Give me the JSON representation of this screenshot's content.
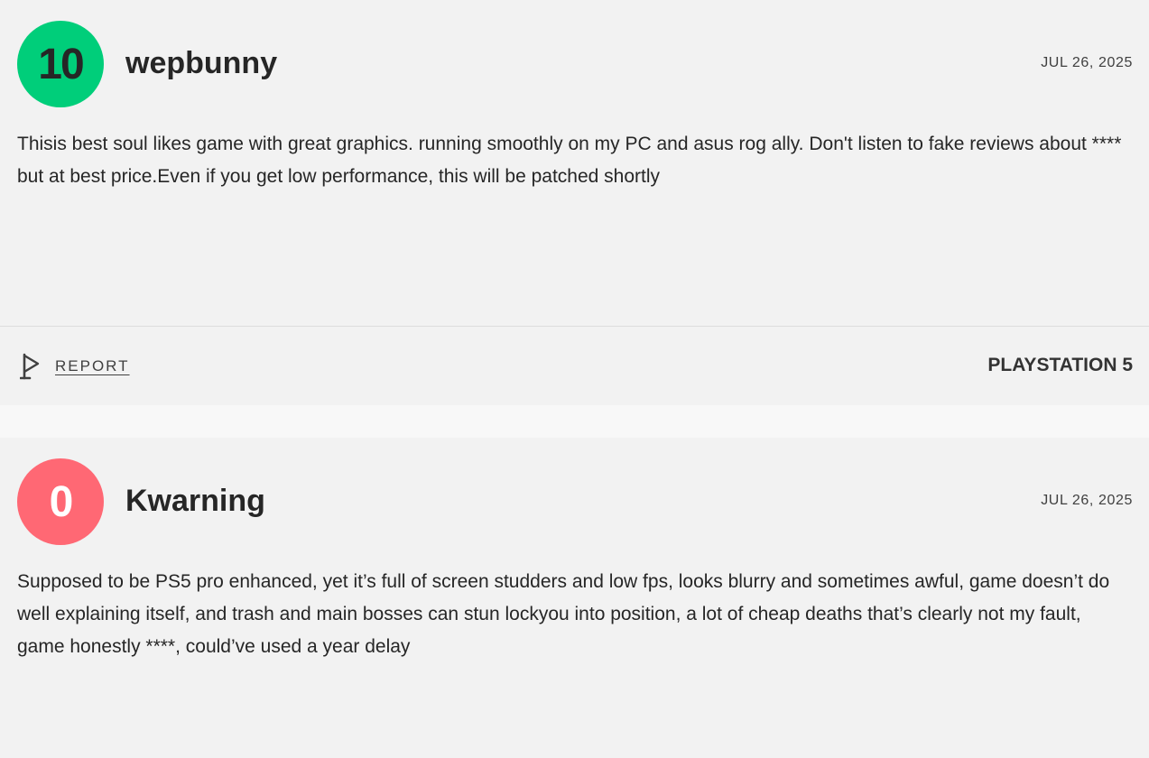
{
  "reviews": [
    {
      "score": "10",
      "score_color": "#00ce7a",
      "username": "wepbunny",
      "date": "JUL 26, 2025",
      "text": "Thisis best soul likes game with great graphics. running smoothly on my PC and asus rog ally. Don't listen to fake reviews about **** but at best price.Even if you get low performance, this will be patched shortly",
      "report_label": "REPORT",
      "report_icon": "flag-icon",
      "platform": "PLAYSTATION 5"
    },
    {
      "score": "0",
      "score_color": "#ff6874",
      "username": "Kwarning",
      "date": "JUL 26, 2025",
      "text": "Supposed to be PS5 pro enhanced, yet it’s full of screen studders and low fps, looks blurry and sometimes awful, game doesn’t do well explaining itself, and trash and main bosses can stun lockyou into position, a lot of cheap deaths that’s clearly not my fault, game honestly ****, could’ve used a year delay"
    }
  ]
}
